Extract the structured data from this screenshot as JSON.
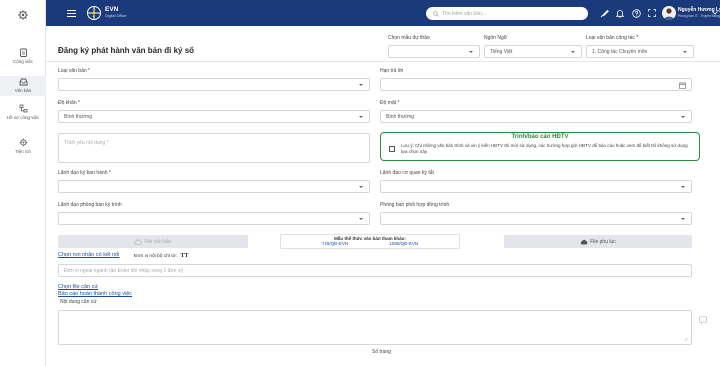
{
  "header": {
    "brand_name": "EVN",
    "brand_subtitle": "Digital Office",
    "search_placeholder": "Tìm kiếm văn bản...",
    "user_name": "Nguyễn Hương Ly",
    "user_role": "Phòng ban IT - Truyền thông",
    "accent_color": "#1a3a7c"
  },
  "sidebar": {
    "items": [
      {
        "label": "",
        "icon": "settings-icon"
      },
      {
        "label": "Công việc",
        "icon": "clipboard-icon"
      },
      {
        "label": "Văn bản",
        "icon": "inbox-icon"
      },
      {
        "label": "Hồ sơ công việc",
        "icon": "sitemap-icon"
      },
      {
        "label": "Tiện ích",
        "icon": "gear-icon"
      }
    ]
  },
  "form": {
    "title": "Đăng ký phát hành văn bản đi ký số",
    "draft_template_label": "Chọn mẫu dự thảo",
    "language_label": "Ngôn Ngữ",
    "language_value": "Tiếng Việt",
    "work_doc_type_label": "Loại văn bản công tác *",
    "work_doc_type_value": "1. Công tác Chuyên môn",
    "doc_type_label": "Loại văn bản *",
    "reply_deadline_label": "Hạn trả lời",
    "urgency_label": "Độ khẩn *",
    "urgency_value": "Bình thường",
    "secrecy_label": "Độ mật *",
    "secrecy_value": "Bình thường",
    "summary_placeholder": "Trích yếu nội dung *",
    "report_box_title": "Trình/báo cáo HĐTV",
    "report_note": "Lưu ý: Chỉ những văn bản trình và xin ý kiến HĐTV thì mới sử dụng, các trường hợp gửi HĐTV để báo cáo hoặc xem để biết thì không sử dụng lựa chọn này.",
    "issuing_leader_label": "Lãnh đạo ký ban hành *",
    "agency_leader_label": "Lãnh đạo cơ quan ký tắt",
    "dept_leader_label": "Lãnh đạo phòng ban ký trình",
    "coordinating_dept_label": "Phòng ban phối hợp đồng trình",
    "file_button": "File văn bản",
    "sample_title": "Mẫu thể thức văn bản tham khảo:",
    "sample_link_1": "729/QĐ-EVN",
    "sample_link_2": "1080/QĐ-EVN",
    "appendix_button": "File phụ lục",
    "recipients_link": "Chọn nơi nhận có kết nối",
    "internal_recipients_label": "Đơn vị nội bộ chỉ tờ:",
    "internal_recipients_value": "TT",
    "external_placeholder": "Đơn vị ngoài ngành (ấn Enter khi nhập xong 1 đơn vị)",
    "basis_file_link": "Chọn file căn cứ",
    "completion_report_link": "Báo cáo hoàn thành công việc",
    "basis_content_label": "Nội dung căn cứ",
    "page_count_label": "Số trang",
    "report_box_color": "#2e8b3e"
  }
}
